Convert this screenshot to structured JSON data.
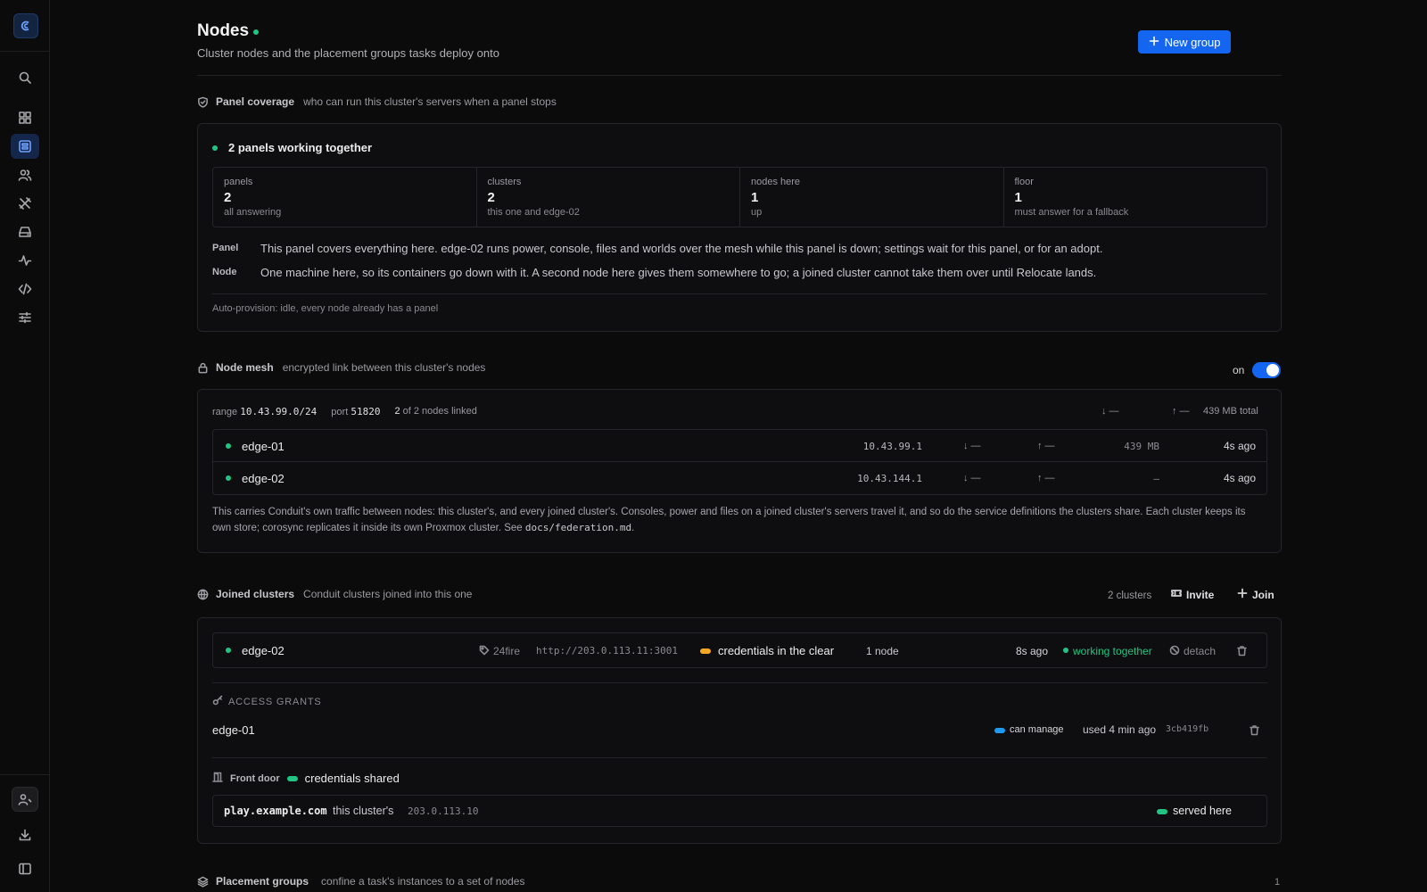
{
  "sidebar": {
    "icons": [
      "logo-icon",
      "search-icon",
      "dashboard-icon",
      "nodes-icon",
      "users-icon",
      "tools-icon",
      "storage-icon",
      "activity-icon",
      "code-icon",
      "settings-sliders-icon",
      "user-icon",
      "download-icon",
      "sidebar-toggle-icon"
    ],
    "active": "nodes-icon"
  },
  "header": {
    "title": "Nodes",
    "subtitle": "Cluster nodes and the placement groups tasks deploy onto",
    "new_group_label": "New group"
  },
  "coverage": {
    "title": "Panel coverage",
    "desc": "who can run this cluster's servers when a panel stops",
    "status": "2 panels working together",
    "stats": [
      {
        "label": "panels",
        "value": "2",
        "sub": "all answering"
      },
      {
        "label": "clusters",
        "value": "2",
        "sub": "this one and edge-02"
      },
      {
        "label": "nodes here",
        "value": "1",
        "sub": "up"
      },
      {
        "label": "floor",
        "value": "1",
        "sub": "must answer for a fallback"
      }
    ],
    "panel_label": "Panel",
    "panel_text": "This panel covers everything here. edge-02 runs power, console, files and worlds over the mesh while this panel is down; settings wait for this panel, or for an adopt.",
    "node_label": "Node",
    "node_text": "One machine here, so its containers go down with it. A second node here gives them somewhere to go; a joined cluster cannot take them over until Relocate lands.",
    "footer": "Auto-provision: idle, every node already has a panel"
  },
  "mesh": {
    "title": "Node mesh",
    "desc": "encrypted link between this cluster's nodes",
    "toggle_label": "on",
    "range_label": "range",
    "range_value": "10.43.99.0/24",
    "port_label": "port",
    "port_value": "51820",
    "linked_count": "2",
    "linked_text": "of 2 nodes linked",
    "total_down": "↓ —",
    "total_up": "↑ —",
    "total_bytes": "439 MB total",
    "nodes": [
      {
        "name": "edge-01",
        "ip": "10.43.99.1",
        "down": "↓ —",
        "up": "↑ —",
        "bytes": "439 MB",
        "ago": "4s ago"
      },
      {
        "name": "edge-02",
        "ip": "10.43.144.1",
        "down": "↓ —",
        "up": "↑ —",
        "bytes": "–",
        "ago": "4s ago"
      }
    ],
    "note_a": "This carries Conduit's own traffic between nodes: this cluster's, and every joined cluster's. Consoles, power and files on a joined cluster's servers travel it, and so do the service definitions the clusters share. Each cluster keeps its own store; corosync replicates it inside its own Proxmox cluster. See ",
    "note_code": "docs/federation.md",
    "note_b": "."
  },
  "joined": {
    "title": "Joined clusters",
    "desc": "Conduit clusters joined into this one",
    "count": "2 clusters",
    "invite_label": "Invite",
    "join_label": "Join",
    "cluster": {
      "name": "edge-02",
      "tag": "24fire",
      "url": "http://203.0.113.11:3001",
      "cred_warning": "credentials in the clear",
      "nodes": "1 node",
      "ago": "8s ago",
      "status": "working together",
      "detach_label": "detach"
    },
    "grants_title": "ACCESS GRANTS",
    "grant": {
      "name": "edge-01",
      "role": "can manage",
      "used": "used 4 min ago",
      "hash": "3cb419fb"
    },
    "front_door_label": "Front door",
    "front_door_status": "credentials shared",
    "front_door": {
      "host": "play.example.com",
      "owner": "this cluster's",
      "ip": "203.0.113.10",
      "status": "served here"
    }
  },
  "placement": {
    "title": "Placement groups",
    "desc": "confine a task's instances to a set of nodes",
    "count": "1"
  },
  "colors": {
    "accent": "#1466f0",
    "ok": "#22c483",
    "warn": "#f5a623",
    "info": "#1e9bf0"
  }
}
